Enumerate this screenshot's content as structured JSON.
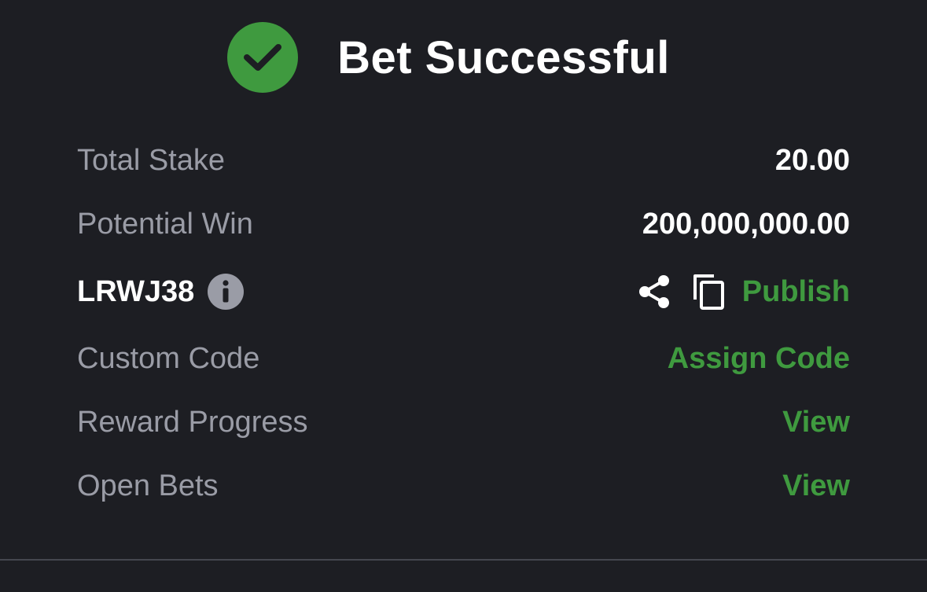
{
  "header": {
    "title": "Bet Successful",
    "icon": "check-circle-icon",
    "accent_color": "#3f9a3f"
  },
  "summary": {
    "total_stake_label": "Total Stake",
    "total_stake_value": "20.00",
    "potential_win_label": "Potential Win",
    "potential_win_value": "200,000,000.00"
  },
  "booking": {
    "code": "LRWJ38",
    "info_icon": "info-icon",
    "share_icon": "share-icon",
    "copy_icon": "copy-icon",
    "publish_label": "Publish"
  },
  "links": {
    "custom_code_label": "Custom Code",
    "custom_code_action": "Assign Code",
    "reward_progress_label": "Reward Progress",
    "reward_progress_action": "View",
    "open_bets_label": "Open Bets",
    "open_bets_action": "View"
  }
}
